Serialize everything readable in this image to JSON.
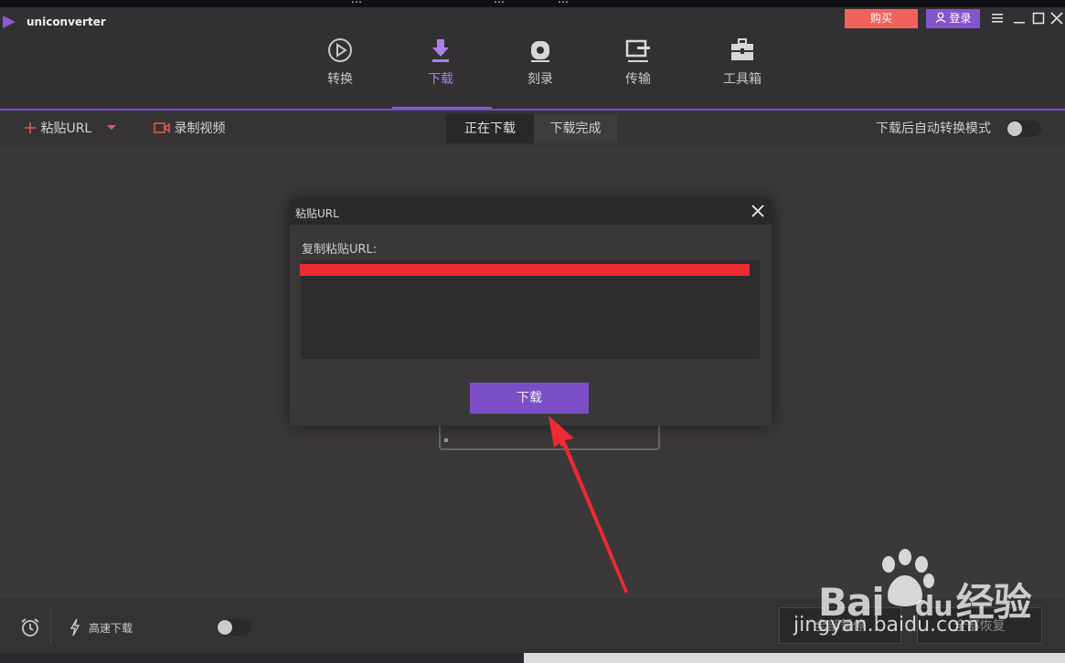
{
  "os_strip": {
    "items": [
      "…",
      "…",
      "…"
    ]
  },
  "app": {
    "name": "uniconverter"
  },
  "header": {
    "buy_label": "购买",
    "login_label": "登录",
    "tabs": [
      {
        "label": "转换",
        "icon": "convert-icon"
      },
      {
        "label": "下载",
        "icon": "download-icon",
        "active": true
      },
      {
        "label": "刻录",
        "icon": "burn-disc-icon"
      },
      {
        "label": "传输",
        "icon": "transfer-icon"
      },
      {
        "label": "工具箱",
        "icon": "toolbox-icon"
      }
    ]
  },
  "toolbar": {
    "paste_url": "粘贴URL",
    "record_video": "录制视频",
    "segments": [
      "正在下载",
      "下载完成"
    ],
    "auto_convert": "下载后自动转换模式"
  },
  "dialog": {
    "title": "粘贴URL",
    "field_label": "复制粘贴URL:",
    "download_button": "下载"
  },
  "bottom": {
    "high_speed": "高速下载",
    "pause_all": "全部暂停",
    "resume_all": "全部恢复"
  },
  "watermark": {
    "brand": "Bai",
    "brand2": "du",
    "cn": "经验",
    "url": "jingyan.baidu.com"
  },
  "colors": {
    "accent": "#7b4ec6",
    "buy": "#f0635b",
    "annotation": "#ee2a33"
  }
}
